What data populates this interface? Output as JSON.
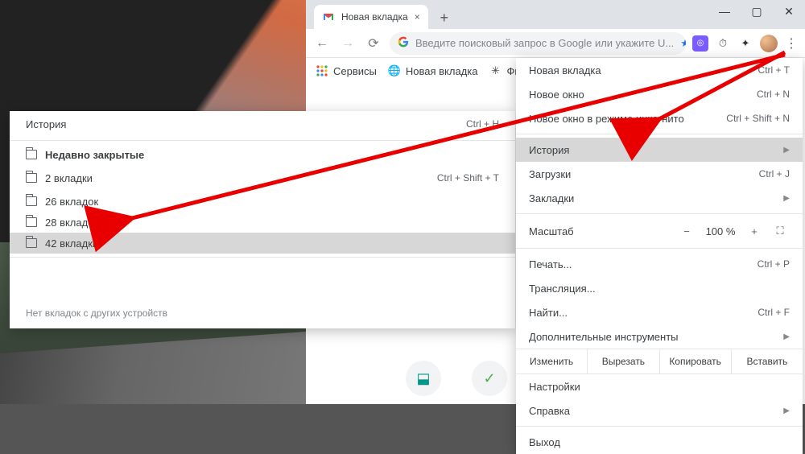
{
  "window": {
    "tab_title": "Новая вкладка"
  },
  "omnibox": {
    "placeholder": "Введите поисковый запрос в Google или укажите U..."
  },
  "bookmarks": [
    {
      "label": "Сервисы"
    },
    {
      "label": "Новая вкладка"
    },
    {
      "label": "Фильм"
    }
  ],
  "menu": {
    "new_tab": {
      "label": "Новая вкладка",
      "shortcut": "Ctrl + T"
    },
    "new_window": {
      "label": "Новое окно",
      "shortcut": "Ctrl + N"
    },
    "incognito": {
      "label": "Новое окно в режиме инкогнито",
      "shortcut": "Ctrl + Shift + N"
    },
    "history": {
      "label": "История"
    },
    "downloads": {
      "label": "Загрузки",
      "shortcut": "Ctrl + J"
    },
    "bookmarks": {
      "label": "Закладки"
    },
    "zoom": {
      "label": "Масштаб",
      "minus": "−",
      "value": "100 %",
      "plus": "+"
    },
    "print": {
      "label": "Печать...",
      "shortcut": "Ctrl + P"
    },
    "cast": {
      "label": "Трансляция..."
    },
    "find": {
      "label": "Найти...",
      "shortcut": "Ctrl + F"
    },
    "more_tools": {
      "label": "Дополнительные инструменты"
    },
    "edit": {
      "label": "Изменить",
      "cut": "Вырезать",
      "copy": "Копировать",
      "paste": "Вставить"
    },
    "settings": {
      "label": "Настройки"
    },
    "help": {
      "label": "Справка"
    },
    "exit": {
      "label": "Выход"
    }
  },
  "history_panel": {
    "title": {
      "label": "История",
      "shortcut": "Ctrl + H"
    },
    "recent": "Недавно закрытые",
    "items": [
      {
        "label": "2 вкладки",
        "shortcut": "Ctrl + Shift + T"
      },
      {
        "label": "26 вкладок",
        "shortcut": ""
      },
      {
        "label": "28 вкладок",
        "shortcut": ""
      },
      {
        "label": "42 вкладки",
        "shortcut": ""
      }
    ],
    "footer": "Нет вкладок с других устройств"
  }
}
